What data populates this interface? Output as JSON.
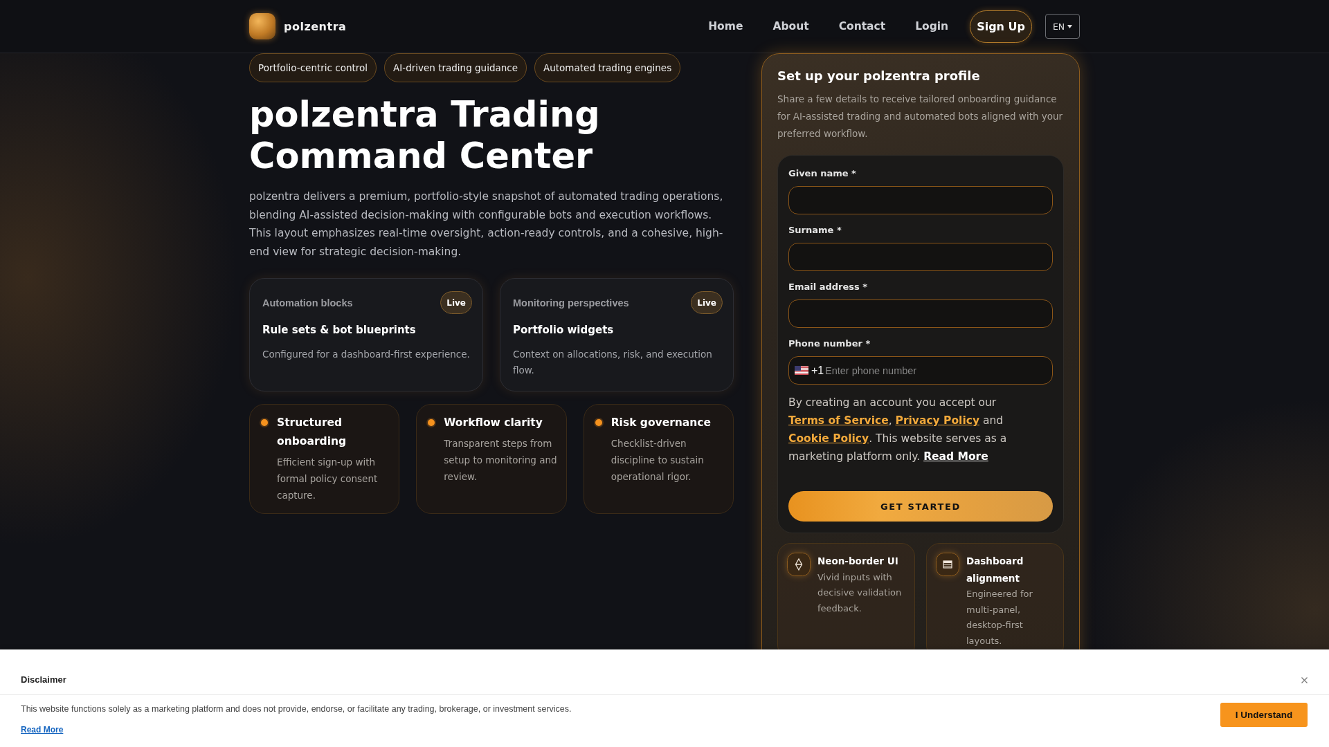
{
  "header": {
    "brand": "polzentra",
    "nav": [
      "Home",
      "About",
      "Contact",
      "Login"
    ],
    "signup": "Sign Up",
    "language": "EN"
  },
  "hero": {
    "tags": [
      "Portfolio-centric control",
      "AI-driven trading guidance",
      "Automated trading engines"
    ],
    "title": "polzentra Trading Command Center",
    "intro": "polzentra delivers a premium, portfolio-style snapshot of automated trading operations, blending AI-assisted decision-making with configurable bots and execution workflows. This layout emphasizes real-time oversight, action-ready controls, and a cohesive, high-end view for strategic decision-making.",
    "highlights": [
      {
        "label": "Automation blocks",
        "badge": "Live",
        "title": "Rule sets & bot blueprints",
        "text": "Configured for a dashboard-first experience."
      },
      {
        "label": "Monitoring perspectives",
        "badge": "Live",
        "title": "Portfolio widgets",
        "text": "Context on allocations, risk, and execution flow."
      }
    ],
    "features": [
      {
        "title": "Structured onboarding",
        "text": "Efficient sign-up with formal policy consent capture."
      },
      {
        "title": "Workflow clarity",
        "text": "Transparent steps from setup to monitoring and review."
      },
      {
        "title": "Risk governance",
        "text": "Checklist-driven discipline to sustain operational rigor."
      }
    ]
  },
  "signup": {
    "title": "Set up your polzentra profile",
    "text": "Share a few details to receive tailored onboarding guidance for AI-assisted trading and automated bots aligned with your preferred workflow.",
    "fields": [
      {
        "kind": "text",
        "label": "Given name *"
      },
      {
        "kind": "text",
        "label": "Surname *"
      },
      {
        "kind": "text",
        "label": "Email address *"
      },
      {
        "kind": "phone",
        "label": "Phone number *",
        "dial_code": "+1",
        "placeholder": "Enter phone number"
      }
    ],
    "consent": [
      {
        "kind": "text",
        "text": "By creating an account you accept our "
      },
      {
        "kind": "link",
        "text": "Terms of Service"
      },
      {
        "kind": "text",
        "text": ", "
      },
      {
        "kind": "link",
        "text": "Privacy Policy"
      },
      {
        "kind": "text",
        "text": " and "
      },
      {
        "kind": "link",
        "text": "Cookie Policy"
      },
      {
        "kind": "text",
        "text": ". This website serves as a marketing platform only. "
      },
      {
        "kind": "more",
        "text": "Read More"
      }
    ],
    "submit": "GET STARTED",
    "perks": [
      {
        "title": "Neon-border UI",
        "text": "Vivid inputs with decisive validation feedback."
      },
      {
        "title": "Dashboard alignment",
        "text": "Engineered for multi-panel, desktop-first layouts."
      }
    ]
  },
  "disclaimer": {
    "title": "Disclaimer",
    "text": "This website functions solely as a marketing platform and does not provide, endorse, or facilitate any trading, brokerage, or investment services.",
    "link": "Read More",
    "button": "I Understand"
  }
}
